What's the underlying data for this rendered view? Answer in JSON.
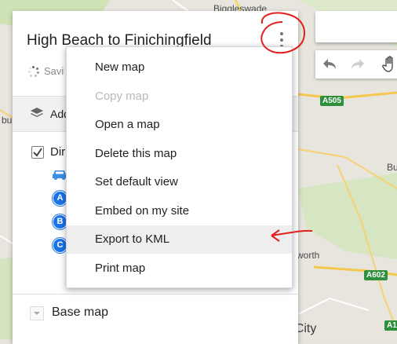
{
  "map": {
    "labels": {
      "biggleswade": "Biggleswade",
      "a505": "A505",
      "a602": "A602",
      "a1": "A1",
      "bu": "Bu",
      "worth": "worth",
      "garden_city": "Garden City",
      "bu_left": "bu"
    }
  },
  "panel": {
    "title": "High Beach to Finichingfield",
    "saving": "Savi",
    "layers_label": "Add",
    "directions_layer": "Dir",
    "markers": [
      "A",
      "B",
      "C"
    ],
    "base_map": "Base map",
    "more_icon": "more-vert-icon"
  },
  "toolbar": {
    "undo_icon": "undo-icon",
    "redo_icon": "redo-icon",
    "pan_icon": "hand-icon"
  },
  "menu": {
    "items": [
      {
        "label": "New map",
        "state": "enabled"
      },
      {
        "label": "Copy map",
        "state": "disabled"
      },
      {
        "label": "Open a map",
        "state": "enabled"
      },
      {
        "label": "Delete this map",
        "state": "enabled"
      },
      {
        "label": "Set default view",
        "state": "enabled"
      },
      {
        "label": "Embed on my site",
        "state": "enabled"
      },
      {
        "label": "Export to KML",
        "state": "hover"
      },
      {
        "label": "Print map",
        "state": "enabled"
      }
    ]
  },
  "colors": {
    "annotation": "#e0201b",
    "marker_blue": "#1a73e8",
    "road_green": "#2e8f3c"
  }
}
